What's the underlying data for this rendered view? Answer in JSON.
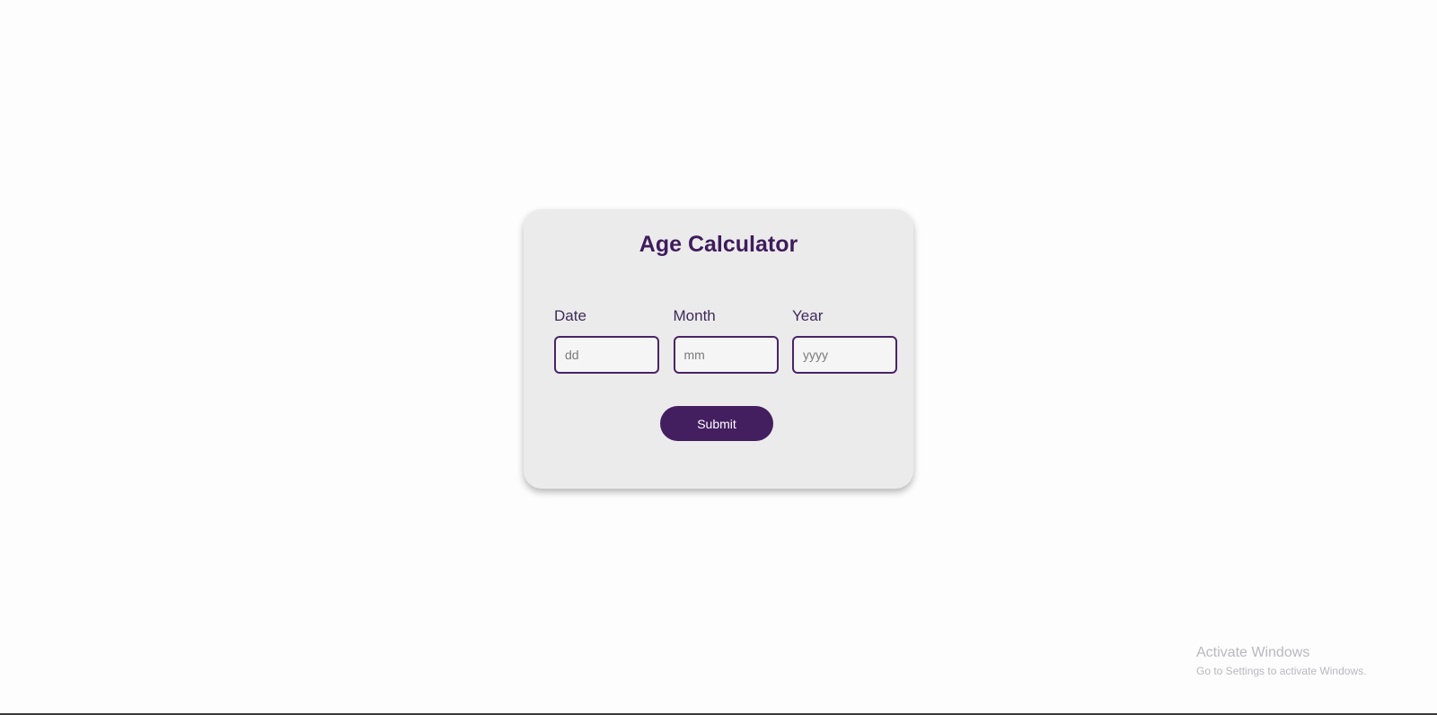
{
  "calculator": {
    "title": "Age Calculator",
    "fields": [
      {
        "label": "Date",
        "placeholder": "dd"
      },
      {
        "label": "Month",
        "placeholder": "mm"
      },
      {
        "label": "Year",
        "placeholder": "yyyy"
      }
    ],
    "submit_label": "Submit"
  },
  "watermark": {
    "title": "Activate Windows",
    "subtitle": "Go to Settings to activate Windows."
  },
  "colors": {
    "accent": "#431f60",
    "card_background": "#ecebec",
    "page_background": "#fdfdfd"
  }
}
